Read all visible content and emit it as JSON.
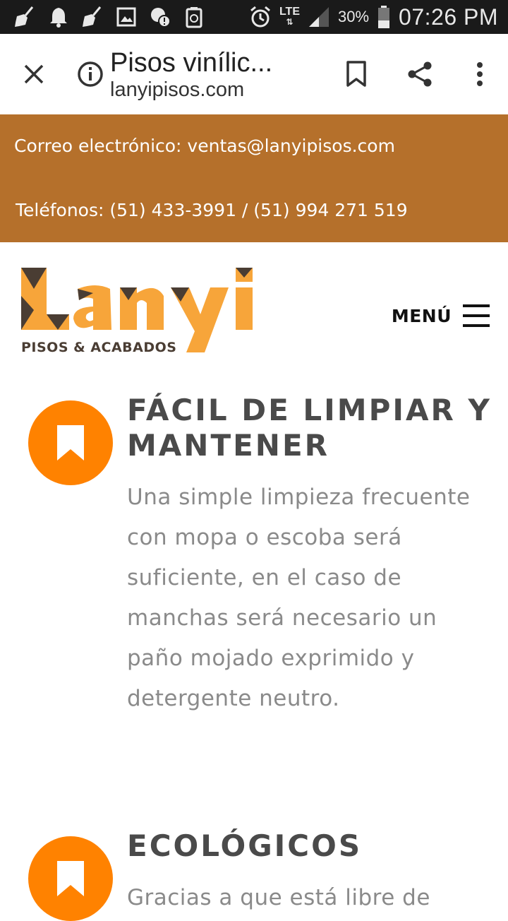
{
  "status_bar": {
    "lte_label": "LTE",
    "battery_percent": "30%",
    "time": "07:26 PM",
    "icons": [
      "broom-icon",
      "alarm-bell-icon",
      "broom-icon",
      "image-icon",
      "chat-alert-icon",
      "recycle-icon",
      "alarm-clock-icon",
      "signal-icon",
      "battery-icon"
    ]
  },
  "browser": {
    "page_title": "Pisos vinílic...",
    "url": "lanyipisos.com"
  },
  "contact": {
    "email_line": "Correo electrónico: ventas@lanyipisos.com",
    "phone_line": "Teléfonos: (51) 433-3991 / (51) 994 271 519"
  },
  "header": {
    "logo_name": "Lanyi",
    "logo_tagline": "PISOS & ACABADOS",
    "menu_label": "MENÚ"
  },
  "features": [
    {
      "title": "FÁCIL DE LIMPIAR Y MANTENER",
      "text": "Una simple limpieza frecuente con mopa o escoba será suficiente, en el caso de manchas será necesario un paño mojado exprimido y detergente neutro."
    },
    {
      "title": "ECOLÓGICOS",
      "text": "Gracias a que está libre de"
    }
  ],
  "colors": {
    "contact_bar": "#b5702b",
    "accent_orange": "#ff8200",
    "logo_orange": "#f7a53a",
    "logo_dark": "#4a3d33",
    "heading": "#4a4a4a",
    "body_text": "#8a8a8a"
  }
}
